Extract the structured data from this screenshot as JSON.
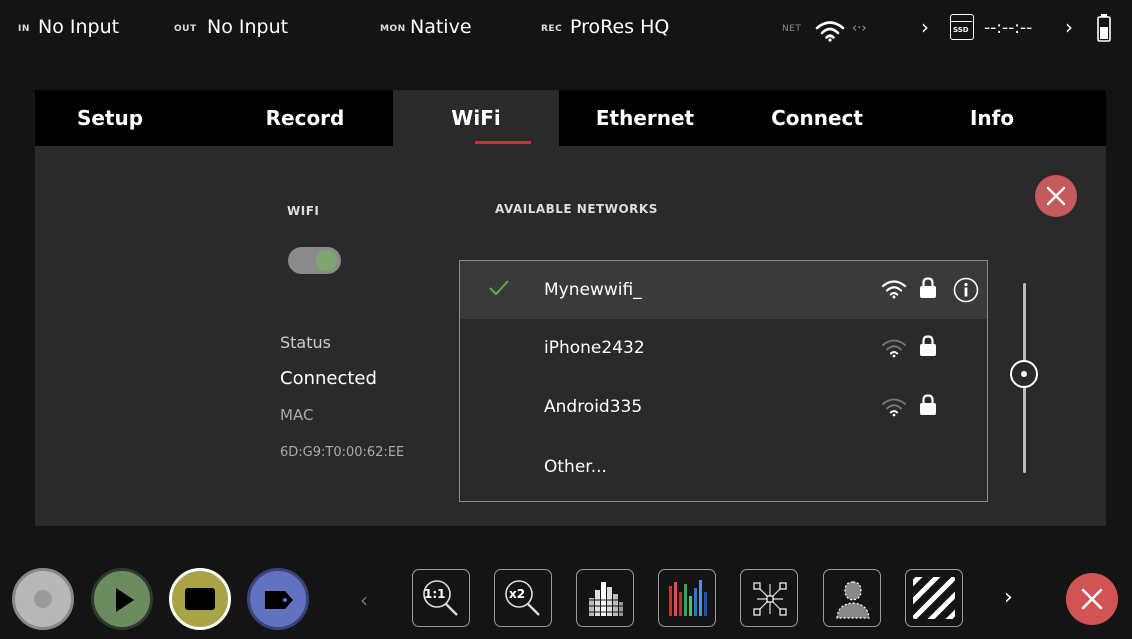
{
  "status_bar": {
    "in_label": "IN",
    "in_value": "No Input",
    "out_label": "OUT",
    "out_value": "No Input",
    "mon_label": "MON",
    "mon_value": "Native",
    "rec_label": "REC",
    "rec_value": "ProRes HQ",
    "net_label": "NET",
    "net_extra": "‹·›",
    "ssd_label": "SSD",
    "timecode": "--:--:--",
    "colors": {
      "bg": "#141414",
      "accent": "#e0262b"
    }
  },
  "tabs": [
    {
      "label": "Setup"
    },
    {
      "label": "Record"
    },
    {
      "label": "WiFi"
    },
    {
      "label": "Ethernet"
    },
    {
      "label": "Connect"
    },
    {
      "label": "Info"
    }
  ],
  "wifi": {
    "section_label": "WIFI",
    "toggle_on": true,
    "status_label": "Status",
    "status_value": "Connected",
    "mac_label": "MAC",
    "mac_value": "6D:G9:T0:00:62:EE"
  },
  "networks": {
    "heading": "AVAILABLE NETWORKS",
    "items": [
      {
        "name": "Mynewwifi_",
        "connected": true,
        "icons": [
          "wifi-icon",
          "lock-icon",
          "info-icon"
        ]
      },
      {
        "name": "iPhone2432",
        "connected": false,
        "icons": [
          "wifi-icon",
          "lock-icon"
        ]
      },
      {
        "name": "Android335",
        "connected": false,
        "icons": [
          "wifi-icon",
          "lock-icon"
        ]
      },
      {
        "name": "Other...",
        "connected": false,
        "icons": []
      }
    ]
  },
  "toolbar": {
    "zoom_1_label": "1:1",
    "zoom_2_label": "x2",
    "buttons": [
      "record-button",
      "play-button",
      "display-button",
      "tag-button"
    ],
    "tools": [
      "zoom-1to1-tool",
      "zoom-x2-tool",
      "waveform-tool",
      "vectorscope-tool",
      "false-color-tool",
      "focus-peaking-tool",
      "zebra-tool"
    ]
  }
}
